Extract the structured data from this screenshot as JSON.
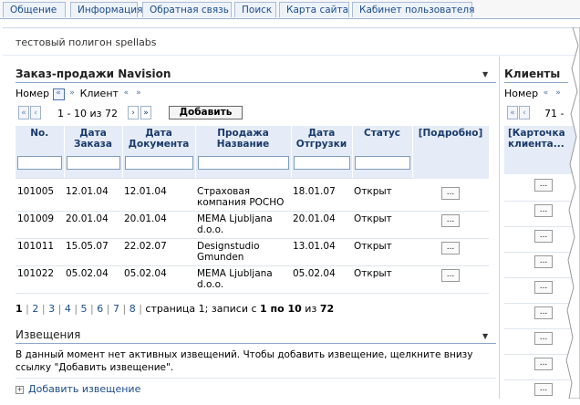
{
  "tabs": [
    "Общение",
    "Информация",
    "Обратная связь",
    "Поиск",
    "Карта сайта",
    "Кабинет пользователя"
  ],
  "site_title": "тестовый полигон spellabs",
  "orders": {
    "title": "Заказ-продажи Navision",
    "sort_label_1": "Номер",
    "sort_label_2": "Клиент",
    "pager_text": "1 - 10 из 72",
    "add_button": "Добавить",
    "columns": [
      "No.",
      "Дата Заказа",
      "Дата Документа",
      "Продажа Название",
      "Дата Отгрузки",
      "Статус",
      "[Подробно]"
    ],
    "rows": [
      {
        "no": "101005",
        "order_date": "12.01.04",
        "doc_date": "12.01.04",
        "name": "Страховая компания POCHO",
        "ship_date": "18.01.07",
        "status": "Открыт"
      },
      {
        "no": "101009",
        "order_date": "20.01.04",
        "doc_date": "20.01.04",
        "name": "MEMA Ljubljana d.o.o.",
        "ship_date": "20.01.04",
        "status": "Открыт"
      },
      {
        "no": "101011",
        "order_date": "15.05.07",
        "doc_date": "22.02.07",
        "name": "Designstudio Gmunden",
        "ship_date": "13.01.04",
        "status": "Открыт"
      },
      {
        "no": "101022",
        "order_date": "05.02.04",
        "doc_date": "05.02.04",
        "name": "MEMA Ljubljana d.o.o.",
        "ship_date": "05.02.04",
        "status": "Открыт"
      }
    ],
    "details_button": "...",
    "page_links": [
      "1",
      "2",
      "3",
      "4",
      "5",
      "6",
      "7",
      "8"
    ],
    "page_summary_prefix": "страница 1; записи с ",
    "page_summary_from_to": "1 по 10",
    "page_summary_of": " из ",
    "page_summary_total": "72"
  },
  "notices": {
    "title": "Извещения",
    "text": "В данный момент нет активных извещений. Чтобы добавить извещение, щелкните внизу ссылку \"Добавить извещение\".",
    "add_link": "Добавить извещение"
  },
  "clients": {
    "title": "Клиенты",
    "sort_label": "Номер",
    "pager_text": "71 -",
    "column": "[Карточка клиента...",
    "details_button": "..."
  },
  "colors": {
    "header_bg": "#e5ecf7",
    "link": "#1b4c8c",
    "tab_border": "#a9bcd8"
  }
}
